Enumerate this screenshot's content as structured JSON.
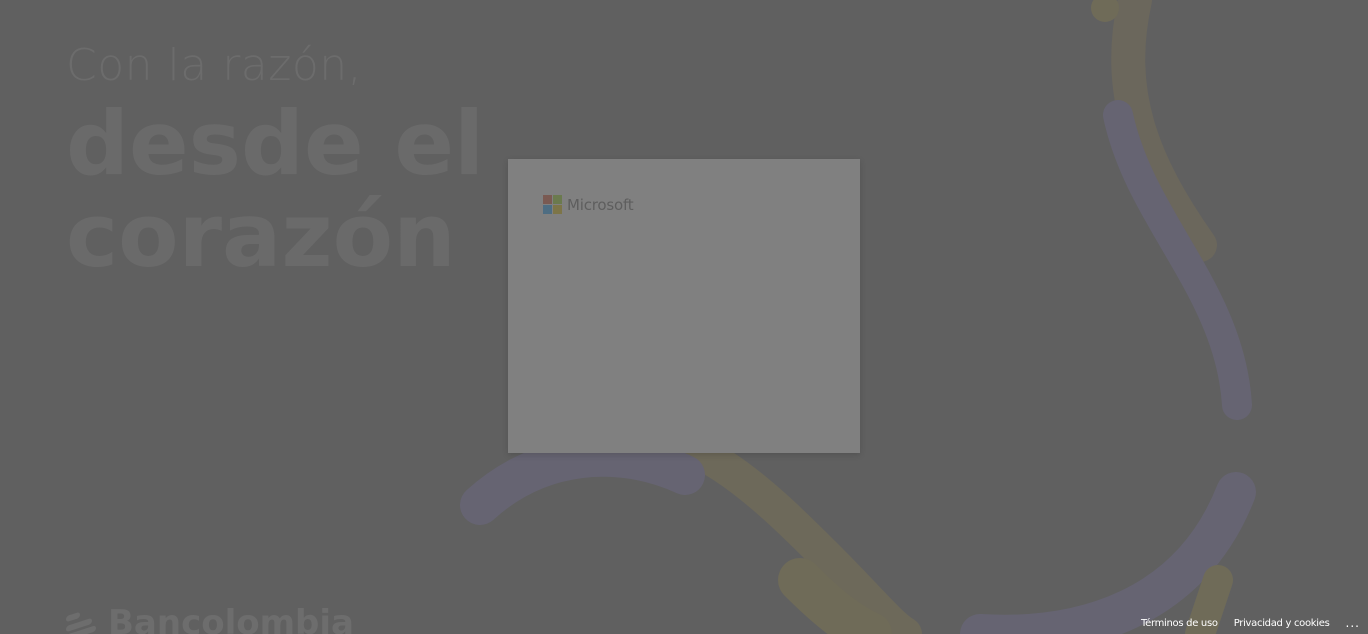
{
  "background": {
    "tagline_line1": "Con la razón,",
    "tagline_line2": "desde el",
    "tagline_line3": "corazón",
    "brand_name": "Bancolombia"
  },
  "signin_card": {
    "logo_text": "Microsoft",
    "logo_colors": [
      "#7a5a52",
      "#6b7a4e",
      "#4e6d82",
      "#7d7548"
    ]
  },
  "footer": {
    "terms_label": "Términos de uso",
    "privacy_label": "Privacidad y cookies",
    "more_label": "..."
  },
  "colors": {
    "page_background": "#606060",
    "card_background": "#808080",
    "accent_gold": "#7a7158",
    "accent_purple": "#666473"
  }
}
